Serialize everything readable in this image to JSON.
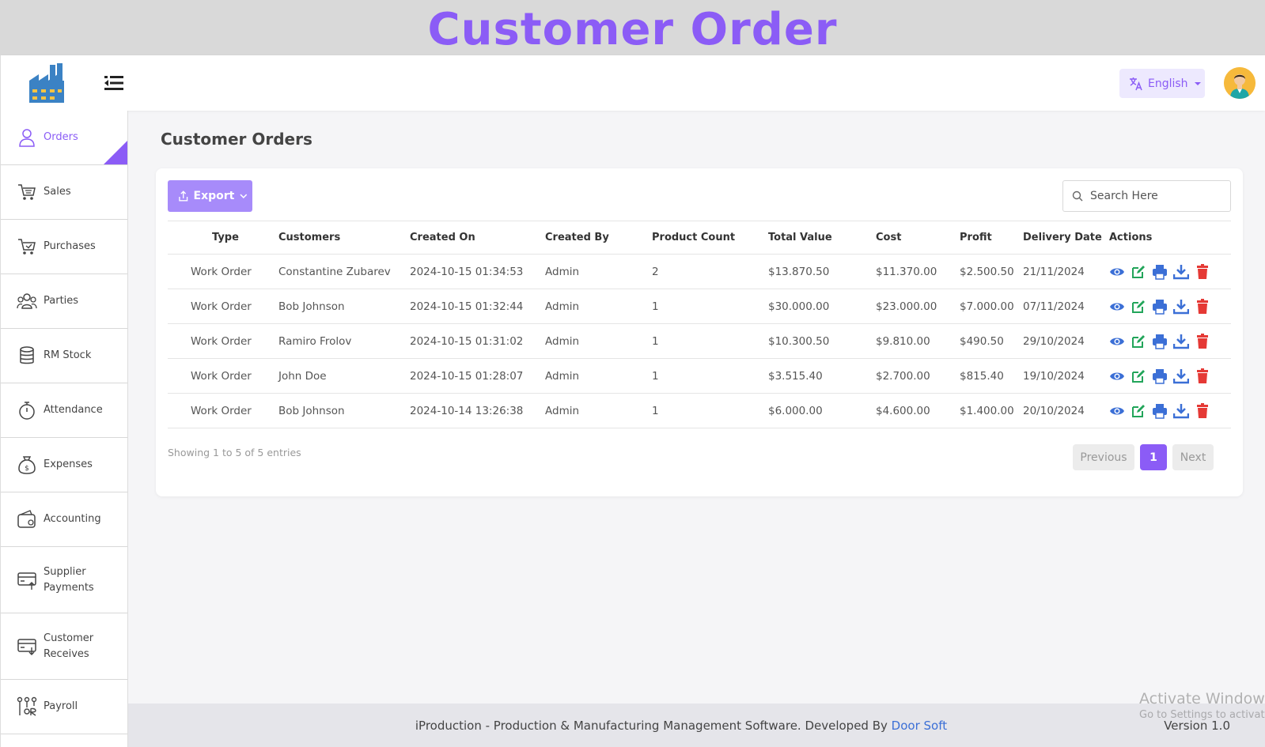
{
  "banner": {
    "title": "Customer Order"
  },
  "topbar": {
    "language": "English"
  },
  "sidebar": {
    "items": [
      {
        "label": "Orders",
        "icon": "user-icon",
        "active": true
      },
      {
        "label": "Sales",
        "icon": "cart-icon"
      },
      {
        "label": "Purchases",
        "icon": "cart-check-icon"
      },
      {
        "label": "Parties",
        "icon": "users-icon"
      },
      {
        "label": "RM Stock",
        "icon": "database-icon"
      },
      {
        "label": "Attendance",
        "icon": "stopwatch-icon"
      },
      {
        "label": "Expenses",
        "icon": "money-bag-icon"
      },
      {
        "label": "Accounting",
        "icon": "wallet-icon"
      },
      {
        "label": "Supplier\nPayments",
        "icon": "card-out-icon"
      },
      {
        "label": "Customer\nReceives",
        "icon": "card-in-icon"
      },
      {
        "label": "Payroll",
        "icon": "payroll-icon"
      }
    ]
  },
  "main": {
    "title": "Customer Orders",
    "export_label": "Export",
    "search_placeholder": "Search Here",
    "columns": [
      "Type",
      "Customers",
      "Created On",
      "Created By",
      "Product Count",
      "Total Value",
      "Cost",
      "Profit",
      "Delivery Date",
      "Actions"
    ],
    "rows": [
      [
        "Work Order",
        "Constantine Zubarev",
        "2024-10-15 01:34:53",
        "Admin",
        "2",
        "$13.870.50",
        "$11.370.00",
        "$2.500.50",
        "21/11/2024"
      ],
      [
        "Work Order",
        "Bob Johnson",
        "2024-10-15 01:32:44",
        "Admin",
        "1",
        "$30.000.00",
        "$23.000.00",
        "$7.000.00",
        "07/11/2024"
      ],
      [
        "Work Order",
        "Ramiro Frolov",
        "2024-10-15 01:31:02",
        "Admin",
        "1",
        "$10.300.50",
        "$9.810.00",
        "$490.50",
        "29/10/2024"
      ],
      [
        "Work Order",
        "John Doe",
        "2024-10-15 01:28:07",
        "Admin",
        "1",
        "$3.515.40",
        "$2.700.00",
        "$815.40",
        "19/10/2024"
      ],
      [
        "Work Order",
        "Bob Johnson",
        "2024-10-14 13:26:38",
        "Admin",
        "1",
        "$6.000.00",
        "$4.600.00",
        "$1.400.00",
        "20/10/2024"
      ]
    ],
    "showing": "Showing 1 to 5 of 5 entries",
    "pagination": {
      "previous": "Previous",
      "current": "1",
      "next": "Next"
    }
  },
  "footer": {
    "text": "iProduction - Production & Manufacturing Management Software. Developed By ",
    "link": "Door Soft",
    "version": "Version 1.0"
  },
  "watermark": {
    "line1": "Activate Windows",
    "line2": "Go to Settings to activate Windows."
  },
  "colors": {
    "accent": "#8b5cf6",
    "view": "#3b6fd6",
    "edit": "#22a55a",
    "delete": "#e53935"
  }
}
